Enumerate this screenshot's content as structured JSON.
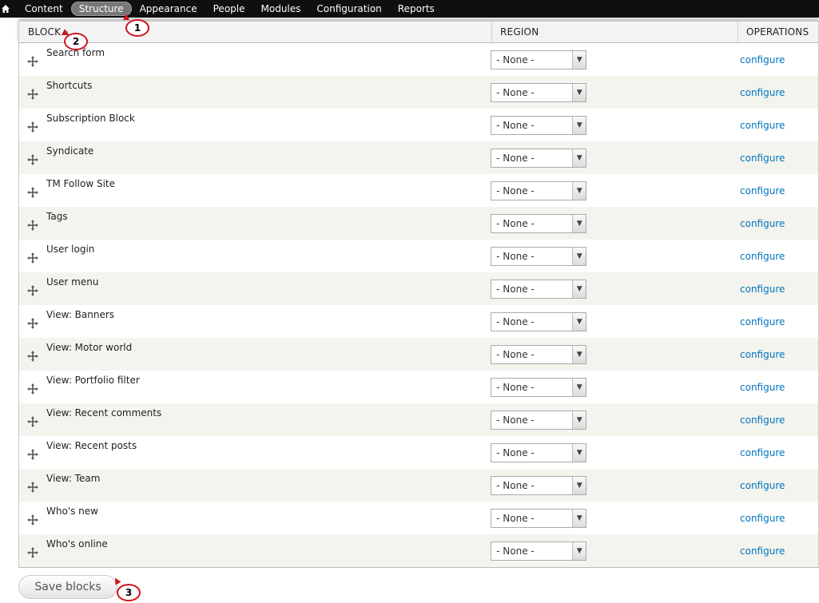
{
  "toolbar": {
    "items": [
      "Content",
      "Structure",
      "Appearance",
      "People",
      "Modules",
      "Configuration",
      "Reports"
    ],
    "active": "Structure"
  },
  "table": {
    "headers": {
      "block": "BLOCK",
      "region": "REGION",
      "operations": "OPERATIONS"
    },
    "rows": [
      {
        "name": "Search form",
        "region": "- None -",
        "op": "configure"
      },
      {
        "name": "Shortcuts",
        "region": "- None -",
        "op": "configure"
      },
      {
        "name": "Subscription Block",
        "region": "- None -",
        "op": "configure"
      },
      {
        "name": "Syndicate",
        "region": "- None -",
        "op": "configure"
      },
      {
        "name": "TM Follow Site",
        "region": "- None -",
        "op": "configure"
      },
      {
        "name": "Tags",
        "region": "- None -",
        "op": "configure"
      },
      {
        "name": "User login",
        "region": "- None -",
        "op": "configure"
      },
      {
        "name": "User menu",
        "region": "- None -",
        "op": "configure"
      },
      {
        "name": "View: Banners",
        "region": "- None -",
        "op": "configure"
      },
      {
        "name": "View: Motor world",
        "region": "- None -",
        "op": "configure"
      },
      {
        "name": "View: Portfolio filter",
        "region": "- None -",
        "op": "configure"
      },
      {
        "name": "View: Recent comments",
        "region": "- None -",
        "op": "configure"
      },
      {
        "name": "View: Recent posts",
        "region": "- None -",
        "op": "configure"
      },
      {
        "name": "View: Team",
        "region": "- None -",
        "op": "configure"
      },
      {
        "name": "Who's new",
        "region": "- None -",
        "op": "configure"
      },
      {
        "name": "Who's online",
        "region": "- None -",
        "op": "configure"
      }
    ]
  },
  "save_label": "Save blocks",
  "callouts": [
    "1",
    "2",
    "3"
  ],
  "colors": {
    "toolbar_bg": "#0f0f0f",
    "link": "#0074bd",
    "callout": "#d0111b",
    "row_stripe": "#f3f4ee"
  }
}
